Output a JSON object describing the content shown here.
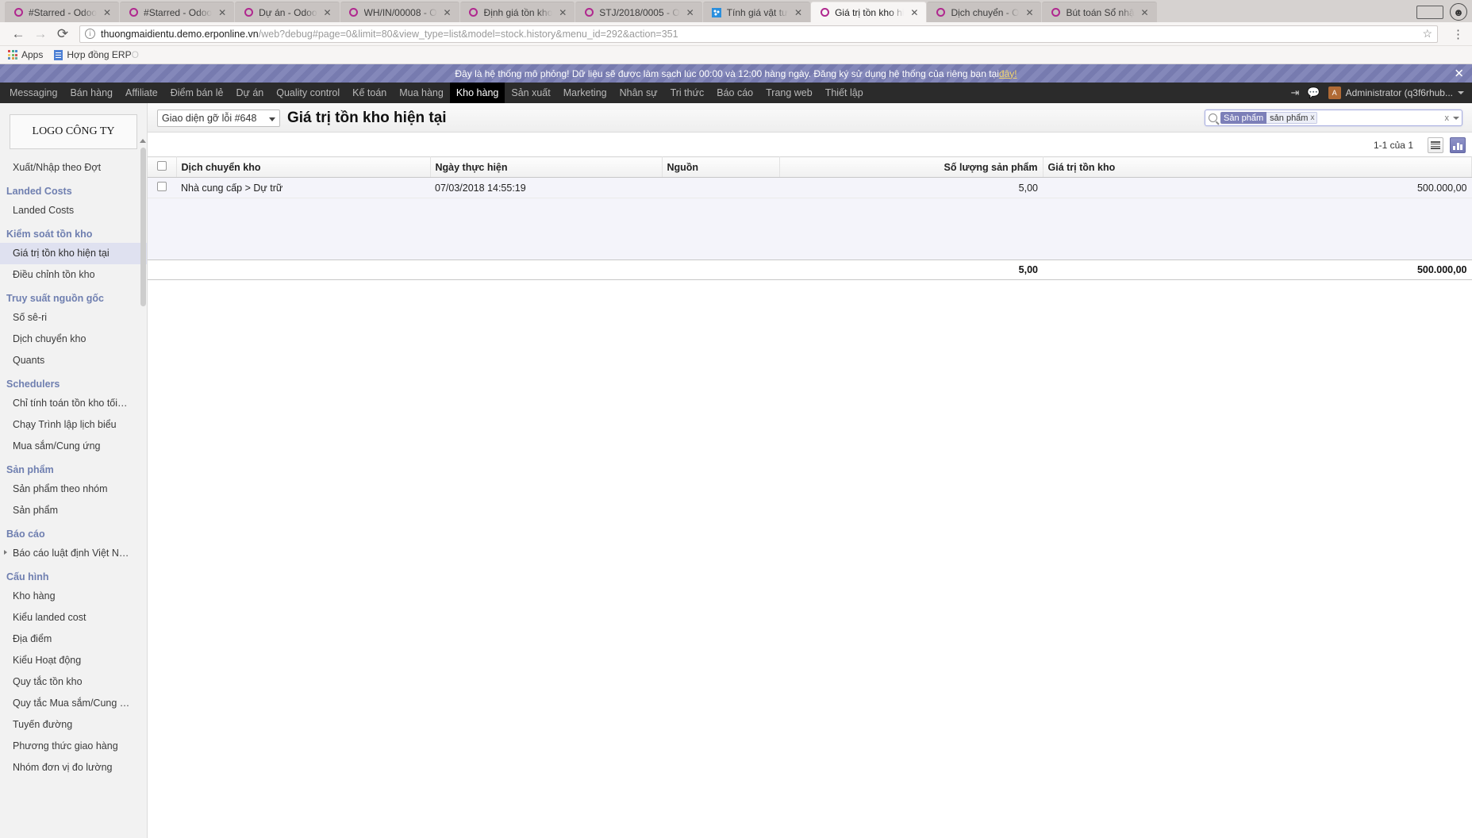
{
  "browser": {
    "tabs": [
      {
        "title": "#Starred - Odoo",
        "favicon": "odoo-icon",
        "active": false
      },
      {
        "title": "#Starred - Odoo",
        "favicon": "odoo-icon",
        "active": false
      },
      {
        "title": "Dự án - Odoo",
        "favicon": "odoo-icon",
        "active": false
      },
      {
        "title": "WH/IN/00008 - O",
        "favicon": "odoo-icon",
        "active": false
      },
      {
        "title": "Định giá tồn kho",
        "favicon": "odoo-icon",
        "active": false
      },
      {
        "title": "STJ/2018/0005 - O",
        "favicon": "odoo-icon",
        "active": false
      },
      {
        "title": "Tính giá vật tư",
        "favicon": "spreadsheet-icon",
        "active": false
      },
      {
        "title": "Giá trị tồn kho hi",
        "favicon": "odoo-icon",
        "active": true
      },
      {
        "title": "Dịch chuyển - O",
        "favicon": "odoo-icon",
        "active": false
      },
      {
        "title": "Bút toán Sổ nhậ",
        "favicon": "odoo-icon",
        "active": false
      }
    ],
    "tab_close_label": "✕",
    "nav": {
      "back": "←",
      "forward": "→",
      "reload": "⟳",
      "star": "☆",
      "menu": "⋮"
    },
    "url": {
      "host": "thuongmaidientu.demo.erponline.vn",
      "path": "/web?debug#page=0&limit=80&view_type=list&model=stock.history&menu_id=292&action=351",
      "info_glyph": "i"
    },
    "bookmarks": {
      "apps_label": "Apps",
      "items": [
        {
          "label": "Hợp đồng ERP",
          "faded_suffix": "O"
        }
      ]
    }
  },
  "banner": {
    "text_before": "Đây là hệ thống mô phỏng! Dữ liệu sẽ được làm sạch lúc 00:00 và 12:00 hàng ngày. Đăng ký sử dụng hệ thống của riêng bạn tại ",
    "link": "đây!",
    "close": "✕"
  },
  "top_menu": {
    "items": [
      {
        "label": "Messaging",
        "active": false
      },
      {
        "label": "Bán hàng",
        "active": false
      },
      {
        "label": "Affiliate",
        "active": false
      },
      {
        "label": "Điểm bán lẻ",
        "active": false
      },
      {
        "label": "Dự án",
        "active": false
      },
      {
        "label": "Quality control",
        "active": false
      },
      {
        "label": "Kế toán",
        "active": false
      },
      {
        "label": "Mua hàng",
        "active": false
      },
      {
        "label": "Kho hàng",
        "active": true
      },
      {
        "label": "Sản xuất",
        "active": false
      },
      {
        "label": "Marketing",
        "active": false
      },
      {
        "label": "Nhân sự",
        "active": false
      },
      {
        "label": "Tri thức",
        "active": false
      },
      {
        "label": "Báo cáo",
        "active": false
      },
      {
        "label": "Trang web",
        "active": false
      },
      {
        "label": "Thiết lập",
        "active": false
      }
    ],
    "user_name": "Administrator (q3f6rhub...",
    "user_initial": "A"
  },
  "sidebar": {
    "logo": "LOGO CÔNG TY",
    "entries": [
      {
        "type": "link",
        "label": "Xuất/Nhập theo Đợt",
        "selected": false
      },
      {
        "type": "header",
        "label": "Landed Costs"
      },
      {
        "type": "link",
        "label": "Landed Costs",
        "selected": false
      },
      {
        "type": "header",
        "label": "Kiểm soát tồn kho"
      },
      {
        "type": "link",
        "label": "Giá trị tồn kho hiện tại",
        "selected": true
      },
      {
        "type": "link",
        "label": "Điều chỉnh tồn kho",
        "selected": false
      },
      {
        "type": "header",
        "label": "Truy suất nguồn gốc"
      },
      {
        "type": "link",
        "label": "Số sê-ri",
        "selected": false
      },
      {
        "type": "link",
        "label": "Dịch chuyển kho",
        "selected": false
      },
      {
        "type": "link",
        "label": "Quants",
        "selected": false
      },
      {
        "type": "header",
        "label": "Schedulers"
      },
      {
        "type": "link",
        "label": "Chỉ tính toán tồn kho tối…",
        "selected": false
      },
      {
        "type": "link",
        "label": "Chạy Trình lập lịch biểu",
        "selected": false
      },
      {
        "type": "link",
        "label": "Mua sắm/Cung ứng",
        "selected": false
      },
      {
        "type": "header",
        "label": "Sản phẩm"
      },
      {
        "type": "link",
        "label": "Sản phẩm theo nhóm",
        "selected": false
      },
      {
        "type": "link",
        "label": "Sản phẩm",
        "selected": false
      },
      {
        "type": "header",
        "label": "Báo cáo"
      },
      {
        "type": "link",
        "label": "Báo cáo luật định Việt N…",
        "selected": false,
        "arrow": true
      },
      {
        "type": "header",
        "label": "Cấu hình"
      },
      {
        "type": "link",
        "label": "Kho hàng",
        "selected": false
      },
      {
        "type": "link",
        "label": "Kiểu landed cost",
        "selected": false
      },
      {
        "type": "link",
        "label": "Địa điểm",
        "selected": false
      },
      {
        "type": "link",
        "label": "Kiểu Hoạt động",
        "selected": false
      },
      {
        "type": "link",
        "label": "Quy tắc tồn kho",
        "selected": false
      },
      {
        "type": "link",
        "label": "Quy tắc Mua sắm/Cung …",
        "selected": false
      },
      {
        "type": "link",
        "label": "Tuyến đường",
        "selected": false
      },
      {
        "type": "link",
        "label": "Phương thức giao hàng",
        "selected": false
      },
      {
        "type": "link",
        "label": "Nhóm đơn vị đo lường",
        "selected": false
      }
    ]
  },
  "control_panel": {
    "debug_view": "Giao diện gỡ lỗi #648",
    "title": "Giá trị tồn kho hiện tại",
    "search": {
      "placeholder": "",
      "facet_label": "Sản phẩm",
      "facet_value": "sản phẩm",
      "facet_remove": "x",
      "clear": "x"
    }
  },
  "list_toolbar": {
    "pager": "1-1 của 1",
    "view_list": "list-view-icon",
    "view_graph": "graph-view-icon"
  },
  "table": {
    "columns": [
      {
        "label": "Dịch chuyển kho",
        "align": "left"
      },
      {
        "label": "Ngày thực hiện",
        "align": "left"
      },
      {
        "label": "Nguồn",
        "align": "left"
      },
      {
        "label": "Số lượng sản phẩm",
        "align": "right"
      },
      {
        "label": "Giá trị tồn kho",
        "align": "right"
      }
    ],
    "rows": [
      {
        "move": "Nhà cung cấp > Dự trữ",
        "date": "07/03/2018 14:55:19",
        "source": "",
        "qty": "5,00",
        "value": "500.000,00"
      }
    ],
    "totals": {
      "qty": "5,00",
      "value": "500.000,00"
    }
  }
}
